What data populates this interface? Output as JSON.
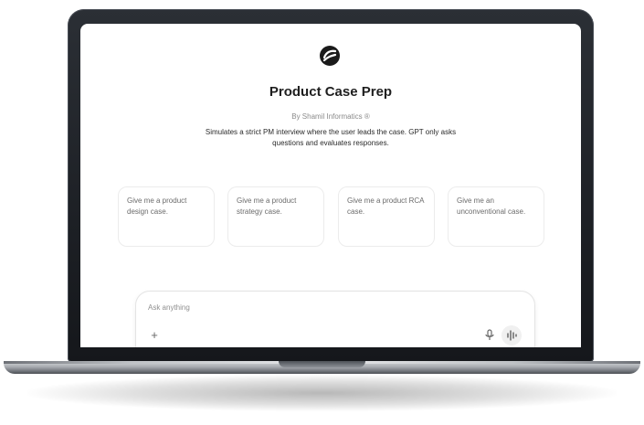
{
  "gpt": {
    "title": "Product Case Prep",
    "byline": "By Shamil Informatics ®",
    "description": "Simulates a strict PM interview where the user leads the case. GPT only asks questions and evaluates responses.",
    "logo_icon": "swoosh-logo-icon"
  },
  "starters": [
    {
      "label": "Give me a product design case."
    },
    {
      "label": "Give me a product strategy case."
    },
    {
      "label": "Give me a product RCA case."
    },
    {
      "label": "Give me an unconventional case."
    }
  ],
  "composer": {
    "placeholder": "Ask anything",
    "attach_icon": "plus-icon",
    "mic_icon": "microphone-icon",
    "voice_icon": "voice-mode-icon"
  },
  "colors": {
    "frame": "#1d2025",
    "screen": "#ffffff",
    "title": "#1f1f1f",
    "muted": "#8a8a8a"
  }
}
